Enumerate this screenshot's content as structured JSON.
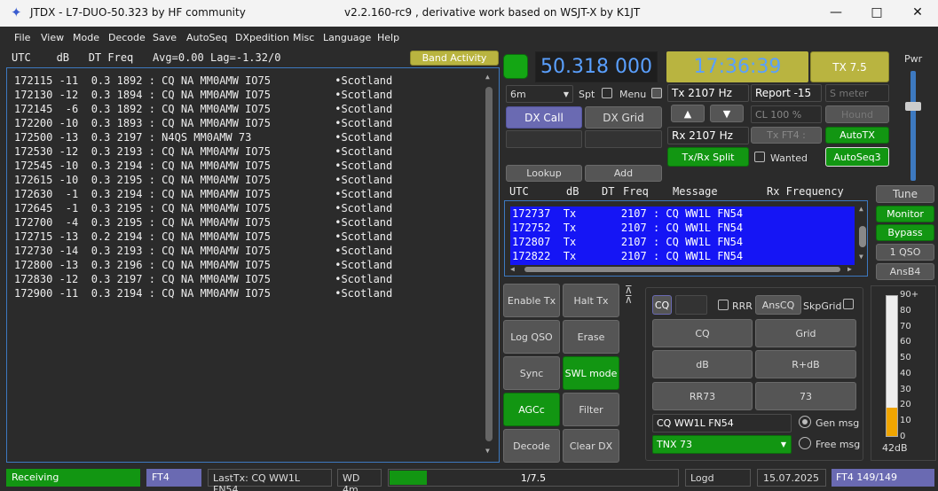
{
  "window": {
    "title": "JTDX - L7-DUO-50.323  by HF community",
    "subtitle": "v2.2.160-rc9 , derivative work based on WSJT-X by K1JT",
    "minimize": "—",
    "maximize": "□",
    "close": "✕"
  },
  "menu": [
    "File",
    "View",
    "Mode",
    "Decode",
    "Save",
    "AutoSeq",
    "DXpedition",
    "Misc",
    "Language",
    "Help"
  ],
  "band_header": {
    "text": "UTC    dB   DT Freq   Avg=0.00 Lag=-1.32/0",
    "band_activity": "Band Activity"
  },
  "decodes": [
    "172115 -11  0.3 1892 : CQ NA MM0AMW IO75          •Scotland",
    "172130 -12  0.3 1894 : CQ NA MM0AMW IO75          •Scotland",
    "172145  -6  0.3 1892 : CQ NA MM0AMW IO75          •Scotland",
    "172200 -10  0.3 1893 : CQ NA MM0AMW IO75          •Scotland",
    "172500 -13  0.3 2197 : N4QS MM0AMW 73             •Scotland",
    "172530 -12  0.3 2193 : CQ NA MM0AMW IO75          •Scotland",
    "172545 -10  0.3 2194 : CQ NA MM0AMW IO75          •Scotland",
    "172615 -10  0.3 2195 : CQ NA MM0AMW IO75          •Scotland",
    "172630  -1  0.3 2194 : CQ NA MM0AMW IO75          •Scotland",
    "172645  -1  0.3 2195 : CQ NA MM0AMW IO75          •Scotland",
    "172700  -4  0.3 2195 : CQ NA MM0AMW IO75          •Scotland",
    "172715 -13  0.2 2194 : CQ NA MM0AMW IO75          •Scotland",
    "172730 -14  0.3 2193 : CQ NA MM0AMW IO75          •Scotland",
    "172800 -13  0.3 2196 : CQ NA MM0AMW IO75          •Scotland",
    "172830 -12  0.3 2197 : CQ NA MM0AMW IO75          •Scotland",
    "172900 -11  0.3 2194 : CQ NA MM0AMW IO75          •Scotland"
  ],
  "freq_display": "50.318 000",
  "time_display": "17:36:39",
  "tx_button": "TX 7.5",
  "pwr_label": "Pwr",
  "band_select": "6m",
  "spt": "Spt",
  "menu_chk": "Menu",
  "tx_hz": "Tx  2107 Hz",
  "rx_hz": "Rx  2107 Hz",
  "report": "Report -15",
  "s_meter": "S meter",
  "dx_call": "DX Call",
  "dx_grid": "DX Grid",
  "up_arrow": "▲",
  "down_arrow": "▼",
  "cl": "CL  100 %",
  "hound": "Hound",
  "tx_ft4": "Tx FT4 :",
  "autotx": "AutoTX",
  "txrx_split": "Tx/Rx Split",
  "wanted": "Wanted",
  "autoseq3": "AutoSeq3",
  "lookup": "Lookup",
  "add": "Add",
  "rx_header": {
    "utc": "UTC",
    "db": "dB",
    "dt": "DT",
    "freq": "Freq",
    "message": "Message",
    "rxfreq": "Rx Frequency"
  },
  "tx_rows": [
    "172737  Tx       2107 : CQ WW1L FN54",
    "172752  Tx       2107 : CQ WW1L FN54",
    "172807  Tx       2107 : CQ WW1L FN54",
    "172822  Tx       2107 : CQ WW1L FN54"
  ],
  "right_buttons": [
    "Tune",
    "Monitor",
    "Bypass",
    "1 QSO",
    "AnsB4"
  ],
  "ctrl_buttons": {
    "enable_tx": "Enable Tx",
    "halt_tx": "Halt Tx",
    "log_qso": "Log QSO",
    "erase": "Erase",
    "sync": "Sync",
    "swl_mode": "SWL mode",
    "agcc": "AGCc",
    "filter": "Filter",
    "decode": "Decode",
    "clear_dx": "Clear DX"
  },
  "msg_panel": {
    "cq_chk": "CQ",
    "rrr": "RRR",
    "anscq": "AnsCQ",
    "skpgrid": "SkpGrid",
    "cq": "CQ",
    "grid": "Grid",
    "db": "dB",
    "rdb": "R+dB",
    "rr73": "RR73",
    "s73": "73",
    "gen_text": "CQ WW1L FN54",
    "gen_msg": "Gen msg",
    "free_text": "TNX 73",
    "free_msg": "Free msg"
  },
  "meter": {
    "ticks": [
      "90+",
      "80",
      "70",
      "60",
      "50",
      "40",
      "30",
      "20",
      "10",
      "0"
    ],
    "level_db": 42,
    "level_label": "42dB"
  },
  "statusbar": {
    "receiving": "Receiving",
    "mode": "FT4",
    "lasttx": "LastTx: CQ WW1L FN54",
    "wd": "WD 4m",
    "progress": "1/7.5",
    "progress_fraction": 0.13,
    "logd": "Logd",
    "date": "15.07.2025",
    "ft4count": "FT4  149/149"
  },
  "colors": {
    "accent_blue": "#1515f5",
    "green": "#129612",
    "yellow": "#b9b440",
    "freq_text": "#5aa0ff"
  }
}
